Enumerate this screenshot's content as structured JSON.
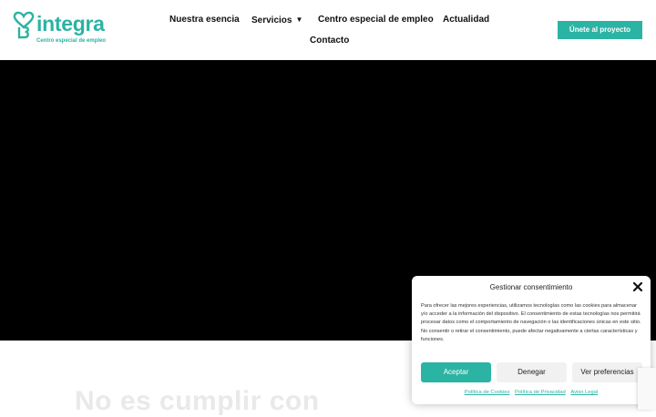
{
  "header": {
    "logo_word": "integra",
    "logo_tagline": "Centro especial de empleo",
    "cta_label": "Únete al proyecto"
  },
  "nav": {
    "items": [
      {
        "label": "Nuestra esencia"
      },
      {
        "label": "Servicios"
      },
      {
        "label": "Centro especial de empleo"
      },
      {
        "label": "Actualidad"
      },
      {
        "label": "Contacto"
      }
    ]
  },
  "hero": {
    "background": "#000000"
  },
  "content": {
    "headline_partial": "No es cumplir con"
  },
  "consent": {
    "title": "Gestionar consentimiento",
    "body": "Para ofrecer las mejores experiencias, utilizamos tecnologías como las cookies para almacenar y/o acceder a la información del dispositivo. El consentimiento de estas tecnologías nos permitirá procesar datos como el comportamiento de navegación o las identificaciones únicas en este sitio. No consentir o retirar el consentimiento, puede afectar negativamente a ciertas características y funciones.",
    "accept_label": "Aceptar",
    "deny_label": "Denegar",
    "prefs_label": "Ver preferencias",
    "links": {
      "cookies": "Política de Cookies",
      "privacy": "Política de Privacidad",
      "legal": "Aviso Legal"
    }
  },
  "colors": {
    "brand": "#2bb3a3",
    "text": "#111111",
    "hero": "#000000"
  }
}
